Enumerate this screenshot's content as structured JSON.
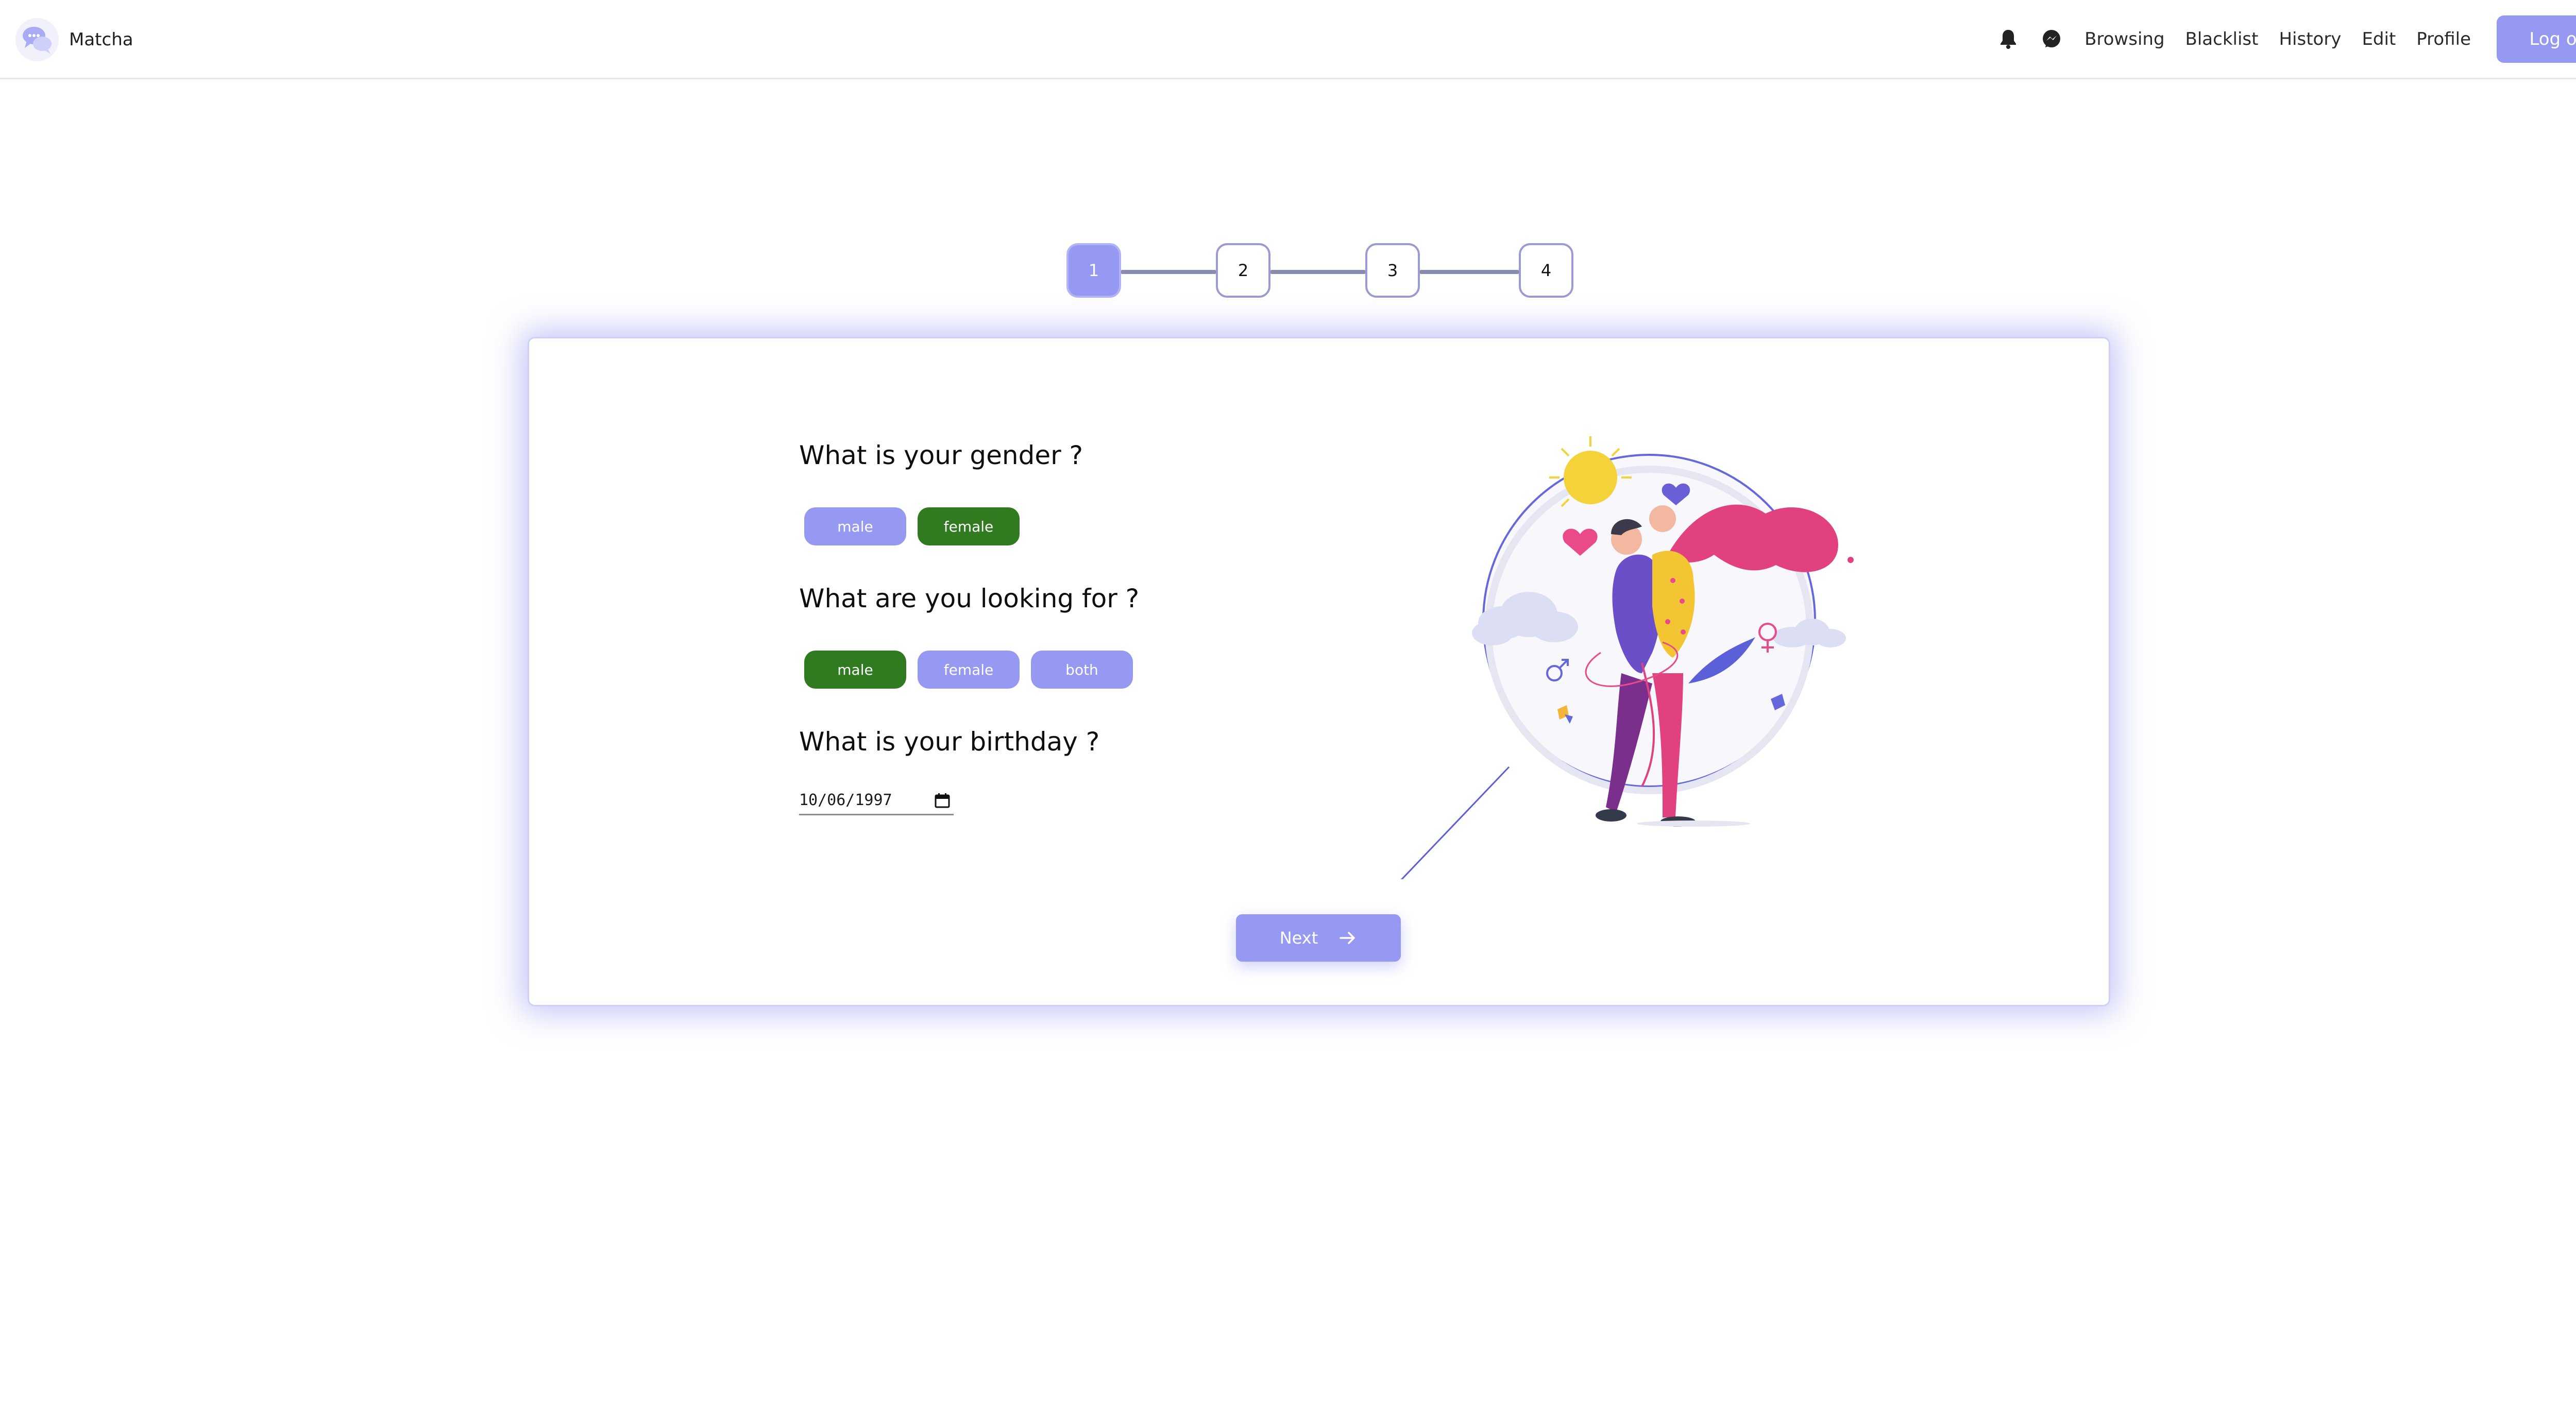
{
  "navbar": {
    "brand": "Matcha",
    "links": [
      "Browsing",
      "Blacklist",
      "History",
      "Edit",
      "Profile"
    ],
    "logout_label": "Log out"
  },
  "stepper": {
    "steps": [
      "1",
      "2",
      "3",
      "4"
    ],
    "active_step": 1
  },
  "form": {
    "gender": {
      "question": "What is your gender ?",
      "options": [
        "male",
        "female"
      ],
      "selected": "female"
    },
    "looking_for": {
      "question": "What are you looking for ?",
      "options": [
        "male",
        "female",
        "both"
      ],
      "selected": "male"
    },
    "birthday": {
      "question": "What is your birthday ?",
      "value": "10/06/1997"
    },
    "next_label": "Next"
  },
  "colors": {
    "accent": "#9699f2",
    "selected": "#307b1f",
    "illustration_pink": "#e84a8a"
  },
  "icons": {
    "logo": "chat-bubbles-icon",
    "notifications": "bell-icon",
    "messages": "messenger-icon",
    "calendar": "calendar-icon",
    "next": "arrow-right-icon"
  }
}
